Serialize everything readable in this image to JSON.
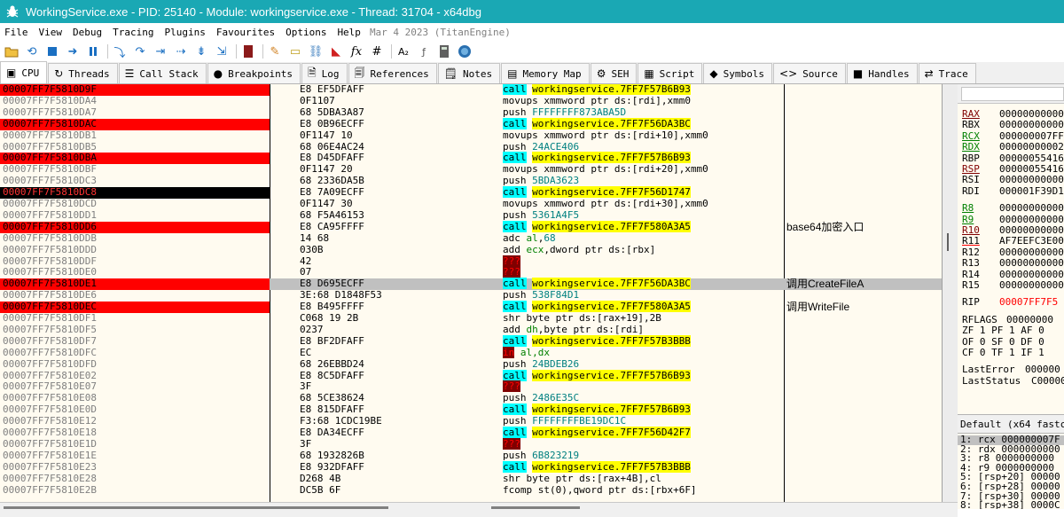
{
  "title": "WorkingService.exe - PID: 25140 - Module: workingservice.exe - Thread: 31704 - x64dbg",
  "menu": [
    "File",
    "View",
    "Debug",
    "Tracing",
    "Plugins",
    "Favourites",
    "Options",
    "Help"
  ],
  "build_info": "Mar 4 2023 (TitanEngine)",
  "toolbar_icons": [
    "open-icon",
    "restart-icon",
    "stop-icon",
    "run-icon",
    "pause-icon",
    "step-into-icon",
    "step-over-icon",
    "trace-into-icon",
    "trace-over-icon",
    "execute-till-return-icon",
    "run-to-user-code-icon",
    "scylla-icon",
    "patch-icon",
    "comment-icon",
    "label-icon",
    "bookmark-icon",
    "highlight-icon",
    "function-icon",
    "hash-icon",
    "font-icon",
    "strings-icon",
    "calculator-icon",
    "help-icon"
  ],
  "tabs": [
    {
      "label": "CPU",
      "icon": "cpu-icon",
      "glyph": "▣",
      "active": true
    },
    {
      "label": "Threads",
      "icon": "threads-icon",
      "glyph": "↻"
    },
    {
      "label": "Call Stack",
      "icon": "callstack-icon",
      "glyph": "☰"
    },
    {
      "label": "Breakpoints",
      "icon": "breakpoint-icon",
      "glyph": "●"
    },
    {
      "label": "Log",
      "icon": "log-icon",
      "glyph": "🗎"
    },
    {
      "label": "References",
      "icon": "references-icon",
      "glyph": "🗐"
    },
    {
      "label": "Notes",
      "icon": "notes-icon",
      "glyph": "🗒"
    },
    {
      "label": "Memory Map",
      "icon": "memory-map-icon",
      "glyph": "▤"
    },
    {
      "label": "SEH",
      "icon": "seh-icon",
      "glyph": "⚙"
    },
    {
      "label": "Script",
      "icon": "script-icon",
      "glyph": "▦"
    },
    {
      "label": "Symbols",
      "icon": "symbols-icon",
      "glyph": "◆"
    },
    {
      "label": "Source",
      "icon": "source-icon",
      "glyph": "<>"
    },
    {
      "label": "Handles",
      "icon": "handles-icon",
      "glyph": "■"
    },
    {
      "label": "Trace",
      "icon": "trace-icon",
      "glyph": "⇄"
    }
  ],
  "disasm": [
    {
      "addr": "00007FF7F5810D9F",
      "mark": "bp",
      "bytes": "E8 EF5DFAFF",
      "mn": "call",
      "ops": "workingservice.7FF7F57B6B93",
      "kind": "call"
    },
    {
      "addr": "00007FF7F5810DA4",
      "bytes": "0F1107",
      "mn": "movups",
      "ops": "xmmword ptr ds:[rdi],xmm0",
      "kind": "mem"
    },
    {
      "addr": "00007FF7F5810DA7",
      "bytes": "68 5DBA3A87",
      "mn": "push",
      "ops": "FFFFFFFF873ABA5D",
      "kind": "imm"
    },
    {
      "addr": "00007FF7F5810DAC",
      "mark": "bp",
      "bytes": "E8 0B96ECFF",
      "mn": "call",
      "ops": "workingservice.7FF7F56DA3BC",
      "kind": "call"
    },
    {
      "addr": "00007FF7F5810DB1",
      "bytes": "0F1147 10",
      "mn": "movups",
      "ops": "xmmword ptr ds:[rdi+10],xmm0",
      "kind": "mem"
    },
    {
      "addr": "00007FF7F5810DB5",
      "bytes": "68 06E4AC24",
      "mn": "push",
      "ops": "24ACE406",
      "kind": "imm"
    },
    {
      "addr": "00007FF7F5810DBA",
      "mark": "bp",
      "bytes": "E8 D45DFAFF",
      "mn": "call",
      "ops": "workingservice.7FF7F57B6B93",
      "kind": "call"
    },
    {
      "addr": "00007FF7F5810DBF",
      "bytes": "0F1147 20",
      "mn": "movups",
      "ops": "xmmword ptr ds:[rdi+20],xmm0",
      "kind": "mem"
    },
    {
      "addr": "00007FF7F5810DC3",
      "bytes": "68 2336DA5B",
      "mn": "push",
      "ops": "5BDA3623",
      "kind": "imm"
    },
    {
      "addr": "00007FF7F5810DC8",
      "mark": "bp-rip",
      "bytes": "E8 7A09ECFF",
      "mn": "call",
      "ops": "workingservice.7FF7F56D1747",
      "kind": "call"
    },
    {
      "addr": "00007FF7F5810DCD",
      "bytes": "0F1147 30",
      "mn": "movups",
      "ops": "xmmword ptr ds:[rdi+30],xmm0",
      "kind": "mem"
    },
    {
      "addr": "00007FF7F5810DD1",
      "bytes": "68 F5A46153",
      "mn": "push",
      "ops": "5361A4F5",
      "kind": "imm"
    },
    {
      "addr": "00007FF7F5810DD6",
      "mark": "bp",
      "bytes": "E8 CA95FFFF",
      "mn": "call",
      "ops": "workingservice.7FF7F580A3A5",
      "kind": "call",
      "comment": "base64加密入口"
    },
    {
      "addr": "00007FF7F5810DDB",
      "bytes": "14 68",
      "mn": "adc",
      "ops": "al,68",
      "kind": "regimm"
    },
    {
      "addr": "00007FF7F5810DDD",
      "bytes": "030B",
      "mn": "add",
      "ops": "ecx,dword ptr ds:[rbx]",
      "kind": "regmem"
    },
    {
      "addr": "00007FF7F5810DDF",
      "bytes": "42",
      "mn": "???",
      "ops": "",
      "kind": "unk"
    },
    {
      "addr": "00007FF7F5810DE0",
      "bytes": "07",
      "mn": "???",
      "ops": "",
      "kind": "unk"
    },
    {
      "addr": "00007FF7F5810DE1",
      "mark": "bp",
      "current": true,
      "bytes": "E8 D695ECFF",
      "mn": "call",
      "ops": "workingservice.7FF7F56DA3BC",
      "kind": "call",
      "comment": "调用CreateFileA"
    },
    {
      "addr": "00007FF7F5810DE6",
      "bytes": "3E:68 D1848F53",
      "mn": "push",
      "ops": "538F84D1",
      "kind": "imm"
    },
    {
      "addr": "00007FF7F5810DEC",
      "mark": "bp",
      "bytes": "E8 B495FFFF",
      "mn": "call",
      "ops": "workingservice.7FF7F580A3A5",
      "kind": "call",
      "comment": "调用WriteFile"
    },
    {
      "addr": "00007FF7F5810DF1",
      "bytes": "C068 19 2B",
      "mn": "shr",
      "ops": "byte ptr ds:[rax+19],2B",
      "kind": "mem"
    },
    {
      "addr": "00007FF7F5810DF5",
      "bytes": "0237",
      "mn": "add",
      "ops": "dh,byte ptr ds:[rdi]",
      "kind": "regmem"
    },
    {
      "addr": "00007FF7F5810DF7",
      "bytes": "E8 BF2DFAFF",
      "mn": "call",
      "ops": "workingservice.7FF7F57B3BBB",
      "kind": "call"
    },
    {
      "addr": "00007FF7F5810DFC",
      "bytes": "EC",
      "mn": "in",
      "ops": "al,dx",
      "kind": "unkops"
    },
    {
      "addr": "00007FF7F5810DFD",
      "bytes": "68 26EBBD24",
      "mn": "push",
      "ops": "24BDEB26",
      "kind": "imm"
    },
    {
      "addr": "00007FF7F5810E02",
      "bytes": "E8 8C5DFAFF",
      "mn": "call",
      "ops": "workingservice.7FF7F57B6B93",
      "kind": "call"
    },
    {
      "addr": "00007FF7F5810E07",
      "bytes": "3F",
      "mn": "???",
      "ops": "",
      "kind": "unk"
    },
    {
      "addr": "00007FF7F5810E08",
      "bytes": "68 5CE38624",
      "mn": "push",
      "ops": "2486E35C",
      "kind": "imm"
    },
    {
      "addr": "00007FF7F5810E0D",
      "bytes": "E8 815DFAFF",
      "mn": "call",
      "ops": "workingservice.7FF7F57B6B93",
      "kind": "call"
    },
    {
      "addr": "00007FF7F5810E12",
      "bytes": "F3:68 1CDC19BE",
      "mn": "push",
      "ops": "FFFFFFFFBE19DC1C",
      "kind": "imm"
    },
    {
      "addr": "00007FF7F5810E18",
      "bytes": "E8 DA34ECFF",
      "mn": "call",
      "ops": "workingservice.7FF7F56D42F7",
      "kind": "call"
    },
    {
      "addr": "00007FF7F5810E1D",
      "bytes": "3F",
      "mn": "???",
      "ops": "",
      "kind": "unk"
    },
    {
      "addr": "00007FF7F5810E1E",
      "bytes": "68 1932826B",
      "mn": "push",
      "ops": "6B823219",
      "kind": "imm"
    },
    {
      "addr": "00007FF7F5810E23",
      "bytes": "E8 932DFAFF",
      "mn": "call",
      "ops": "workingservice.7FF7F57B3BBB",
      "kind": "call"
    },
    {
      "addr": "00007FF7F5810E28",
      "bytes": "D268 4B",
      "mn": "shr",
      "ops": "byte ptr ds:[rax+4B],cl",
      "kind": "mem"
    },
    {
      "addr": "00007FF7F5810E2B",
      "bytes": "DC5B 6F",
      "mn": "fcomp",
      "ops": "st(0),qword ptr ds:[rbx+6F]",
      "kind": "mem"
    }
  ],
  "registers": [
    {
      "name": "RAX",
      "value": "00000000000",
      "style": "mod"
    },
    {
      "name": "RBX",
      "value": "00000000000",
      "style": ""
    },
    {
      "name": "RCX",
      "value": "000000007FF",
      "style": "green-under"
    },
    {
      "name": "RDX",
      "value": "00000000002",
      "style": "green-under"
    },
    {
      "name": "RBP",
      "value": "000000554160",
      "style": ""
    },
    {
      "name": "RSP",
      "value": "000000554160",
      "style": "mod"
    },
    {
      "name": "RSI",
      "value": "00000000000",
      "style": ""
    },
    {
      "name": "RDI",
      "value": "000001F39D1",
      "style": ""
    },
    {
      "name": "",
      "value": "",
      "style": ""
    },
    {
      "name": "R8",
      "value": "00000000000",
      "style": "green-under"
    },
    {
      "name": "R9",
      "value": "00000000000",
      "style": "green-under"
    },
    {
      "name": "R10",
      "value": "00000000000",
      "style": "mod"
    },
    {
      "name": "R11",
      "value": "AF7EEFC3E00",
      "style": "red-under"
    },
    {
      "name": "R12",
      "value": "00000000000",
      "style": ""
    },
    {
      "name": "R13",
      "value": "00000000000",
      "style": ""
    },
    {
      "name": "R14",
      "value": "00000000000",
      "style": ""
    },
    {
      "name": "R15",
      "value": "00000000000",
      "style": ""
    },
    {
      "name": "",
      "value": "",
      "style": ""
    },
    {
      "name": "RIP",
      "value": "00007FF7F5",
      "style": "rip"
    },
    {
      "name": "",
      "value": "",
      "style": ""
    },
    {
      "name": "RFLAGS",
      "value": "00000000",
      "style": "wide"
    },
    {
      "name": "flags1",
      "value": "ZF 1  PF 1  AF 0",
      "style": "line"
    },
    {
      "name": "flags2",
      "value": "OF 0  SF 0  DF 0",
      "style": "line"
    },
    {
      "name": "flags3",
      "value": "CF 0  TF 1  IF 1",
      "style": "line"
    },
    {
      "name": "",
      "value": "",
      "style": ""
    },
    {
      "name": "LastError",
      "value": "000000",
      "style": "wide"
    },
    {
      "name": "LastStatus",
      "value": "C00000",
      "style": "wide"
    }
  ],
  "callconv_label": "Default (x64 fastcall)",
  "args": [
    "1: rcx 000000007F",
    "2: rdx 0000000000",
    "3: r8 0000000000",
    "4: r9 0000000000",
    "5: [rsp+20] 00000",
    "6: [rsp+28] 00000",
    "7: [rsp+30] 00000",
    "8: [rsp+38] 0000C"
  ]
}
